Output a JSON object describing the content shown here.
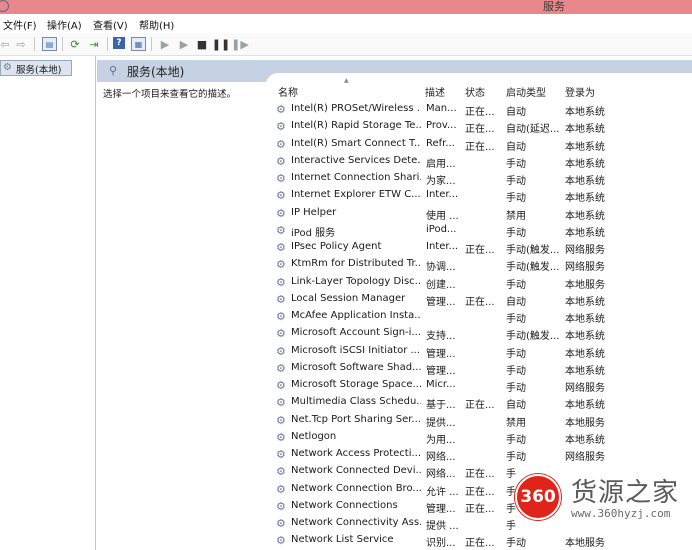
{
  "window": {
    "title": "服务"
  },
  "menu": [
    {
      "label": "文件(F)"
    },
    {
      "label": "操作(A)"
    },
    {
      "label": "查看(V)"
    },
    {
      "label": "帮助(H)"
    }
  ],
  "toolbar": {
    "icons": [
      "back-arrow-icon",
      "forward-arrow-icon",
      "show-hide-console-tree-icon",
      "refresh-icon",
      "export-list-icon",
      "help-icon",
      "properties-icon",
      "start-service-icon",
      "start-service-alt-icon",
      "stop-service-icon",
      "pause-service-icon",
      "restart-service-icon"
    ]
  },
  "tree": {
    "selected_label": "服务(本地)"
  },
  "panel": {
    "title": "服务(本地)",
    "description": "选择一个项目来查看它的描述。"
  },
  "columns": {
    "name": "名称",
    "desc": "描述",
    "status": "状态",
    "startup": "启动类型",
    "logon": "登录为"
  },
  "services": [
    {
      "name": "Intel(R) PROSet/Wireless ...",
      "desc": "Man...",
      "status": "正在...",
      "startup": "自动",
      "logon": "本地系统"
    },
    {
      "name": "Intel(R) Rapid Storage Te...",
      "desc": "Prov...",
      "status": "正在...",
      "startup": "自动(延迟...",
      "logon": "本地系统"
    },
    {
      "name": "Intel(R) Smart Connect T...",
      "desc": "Refr...",
      "status": "正在...",
      "startup": "自动",
      "logon": "本地系统"
    },
    {
      "name": "Interactive Services Dete...",
      "desc": "启用...",
      "status": "",
      "startup": "手动",
      "logon": "本地系统"
    },
    {
      "name": "Internet Connection Shari...",
      "desc": "为家...",
      "status": "",
      "startup": "手动",
      "logon": "本地系统"
    },
    {
      "name": "Internet Explorer ETW C...",
      "desc": "Inter...",
      "status": "",
      "startup": "手动",
      "logon": "本地系统"
    },
    {
      "name": "IP Helper",
      "desc": "使用 ...",
      "status": "",
      "startup": "禁用",
      "logon": "本地系统"
    },
    {
      "name": "iPod 服务",
      "desc": "iPod...",
      "status": "",
      "startup": "手动",
      "logon": "本地系统"
    },
    {
      "name": "IPsec Policy Agent",
      "desc": "Inter...",
      "status": "正在...",
      "startup": "手动(触发...",
      "logon": "网络服务"
    },
    {
      "name": "KtmRm for Distributed Tr...",
      "desc": "协调...",
      "status": "",
      "startup": "手动(触发...",
      "logon": "网络服务"
    },
    {
      "name": "Link-Layer Topology Disc...",
      "desc": "创建...",
      "status": "",
      "startup": "手动",
      "logon": "本地服务"
    },
    {
      "name": "Local Session Manager",
      "desc": "管理...",
      "status": "正在...",
      "startup": "自动",
      "logon": "本地系统"
    },
    {
      "name": "McAfee Application Insta...",
      "desc": "",
      "status": "",
      "startup": "手动",
      "logon": "本地系统"
    },
    {
      "name": "Microsoft Account Sign-i...",
      "desc": "支持...",
      "status": "",
      "startup": "手动(触发...",
      "logon": "本地系统"
    },
    {
      "name": "Microsoft iSCSI Initiator ...",
      "desc": "管理...",
      "status": "",
      "startup": "手动",
      "logon": "本地系统"
    },
    {
      "name": "Microsoft Software Shad...",
      "desc": "管理...",
      "status": "",
      "startup": "手动",
      "logon": "本地系统"
    },
    {
      "name": "Microsoft Storage Space...",
      "desc": "Micr...",
      "status": "",
      "startup": "手动",
      "logon": "网络服务"
    },
    {
      "name": "Multimedia Class Schedu...",
      "desc": "基于...",
      "status": "正在...",
      "startup": "自动",
      "logon": "本地系统"
    },
    {
      "name": "Net.Tcp Port Sharing Ser...",
      "desc": "提供...",
      "status": "",
      "startup": "禁用",
      "logon": "本地服务"
    },
    {
      "name": "Netlogon",
      "desc": "为用...",
      "status": "",
      "startup": "手动",
      "logon": "本地系统"
    },
    {
      "name": "Network Access Protecti...",
      "desc": "网络...",
      "status": "",
      "startup": "手动",
      "logon": "网络服务"
    },
    {
      "name": "Network Connected Devi...",
      "desc": "网络...",
      "status": "正在...",
      "startup": "手",
      "logon": ""
    },
    {
      "name": "Network Connection Bro...",
      "desc": "允许 ...",
      "status": "正在...",
      "startup": "手",
      "logon": ""
    },
    {
      "name": "Network Connections",
      "desc": "管理...",
      "status": "正在...",
      "startup": "手",
      "logon": ""
    },
    {
      "name": "Network Connectivity Ass...",
      "desc": "提供 ...",
      "status": "",
      "startup": "手",
      "logon": ""
    },
    {
      "name": "Network List Service",
      "desc": "识别...",
      "status": "正在...",
      "startup": "手动",
      "logon": "本地服务"
    }
  ],
  "watermark": {
    "logo_text": "360",
    "brand": "货源之家",
    "url": "www.360hyzj.com"
  }
}
